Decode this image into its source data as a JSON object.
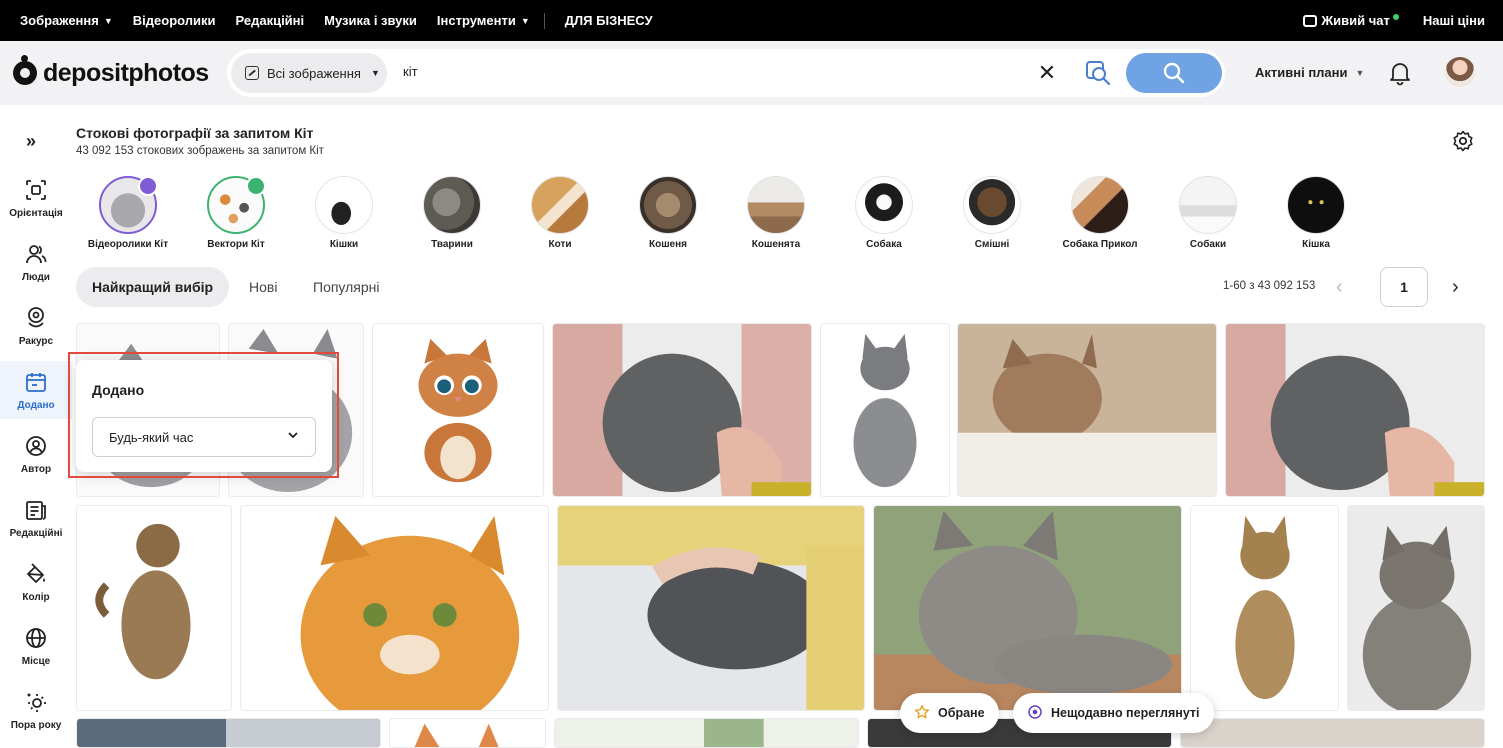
{
  "topbar": {
    "nav": [
      {
        "label": "Зображення",
        "caret": true
      },
      {
        "label": "Відеоролики",
        "caret": false
      },
      {
        "label": "Редакційні",
        "caret": false
      },
      {
        "label": "Музика і звуки",
        "caret": false
      },
      {
        "label": "Інструменти",
        "caret": true
      }
    ],
    "business": "ДЛЯ БІЗНЕСУ",
    "live_chat": "Живий чат",
    "prices": "Наші ціни"
  },
  "header": {
    "logo": "depositphotos",
    "search_type": "Всі зображення",
    "query": "кіт",
    "plans": "Активні плани"
  },
  "sidebar": {
    "items": [
      {
        "label": "Орієнтація",
        "icon": "orientation-icon"
      },
      {
        "label": "Люди",
        "icon": "people-icon"
      },
      {
        "label": "Ракурс",
        "icon": "angle-icon"
      },
      {
        "label": "Додано",
        "icon": "calendar-icon",
        "active": true
      },
      {
        "label": "Автор",
        "icon": "author-icon"
      },
      {
        "label": "Редакційні",
        "icon": "editorial-icon"
      },
      {
        "label": "Колір",
        "icon": "color-icon"
      },
      {
        "label": "Місце",
        "icon": "globe-icon"
      },
      {
        "label": "Пора року",
        "icon": "season-icon"
      }
    ]
  },
  "results": {
    "title": "Стокові фотографії за запитом Кіт",
    "subtitle": "43 092 153 стокових зображень за запитом Кіт"
  },
  "categories": [
    {
      "name": "Відеоролики Кіт"
    },
    {
      "name": "Вектори Кіт"
    },
    {
      "name": "Кішки"
    },
    {
      "name": "Тварини"
    },
    {
      "name": "Коти"
    },
    {
      "name": "Кошеня"
    },
    {
      "name": "Кошенята"
    },
    {
      "name": "Собака"
    },
    {
      "name": "Смішні"
    },
    {
      "name": "Собака Прикол"
    },
    {
      "name": "Собаки"
    },
    {
      "name": "Кішка"
    }
  ],
  "tabs": [
    {
      "label": "Найкращий вибір",
      "active": true
    },
    {
      "label": "Нові",
      "active": false
    },
    {
      "label": "Популярні",
      "active": false
    }
  ],
  "pagination": {
    "info": "1-60 з 43 092 153",
    "page": "1"
  },
  "popup": {
    "title": "Додано",
    "select_value": "Будь-який час"
  },
  "floating": {
    "favorites": "Обране",
    "recent": "Нещодавно переглянуті"
  },
  "colors": {
    "accent": "#6fa3e4",
    "active_sidebar": "#2d6ec9",
    "highlight": "#e24a3b"
  }
}
